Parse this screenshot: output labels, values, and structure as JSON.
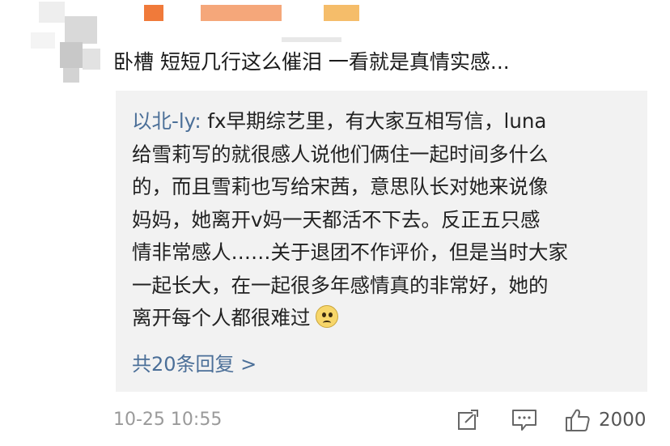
{
  "comment": {
    "text": "卧槽 短短几行这么催泪 一看就是真情实感..."
  },
  "reply": {
    "author": "以北-ly:",
    "lines": [
      " fx早期综艺里，有大家互相写信，luna",
      "给雪莉写的就很感人说他们俩住一起时间多什么",
      "的，而且雪莉也写给宋茜，意思队长对她来说像",
      "妈妈，她离开v妈一天都活不下去。反正五只感",
      "情非常感人……关于退团不作评价，但是当时大家",
      "一起长大，在一起很多年感情真的非常好，她的",
      "离开每个人都很难过"
    ],
    "emoji": "sad-face-emoji",
    "more_replies": "共20条回复 >"
  },
  "footer": {
    "timestamp": "10-25 10:55",
    "share_icon": "share-icon",
    "comment_icon": "comment-icon",
    "like_icon": "thumbs-up-icon",
    "like_count": "2000"
  },
  "colors": {
    "link": "#4b6f98",
    "reply_bg": "#f2f2f2",
    "meta": "#9a9a9a"
  }
}
